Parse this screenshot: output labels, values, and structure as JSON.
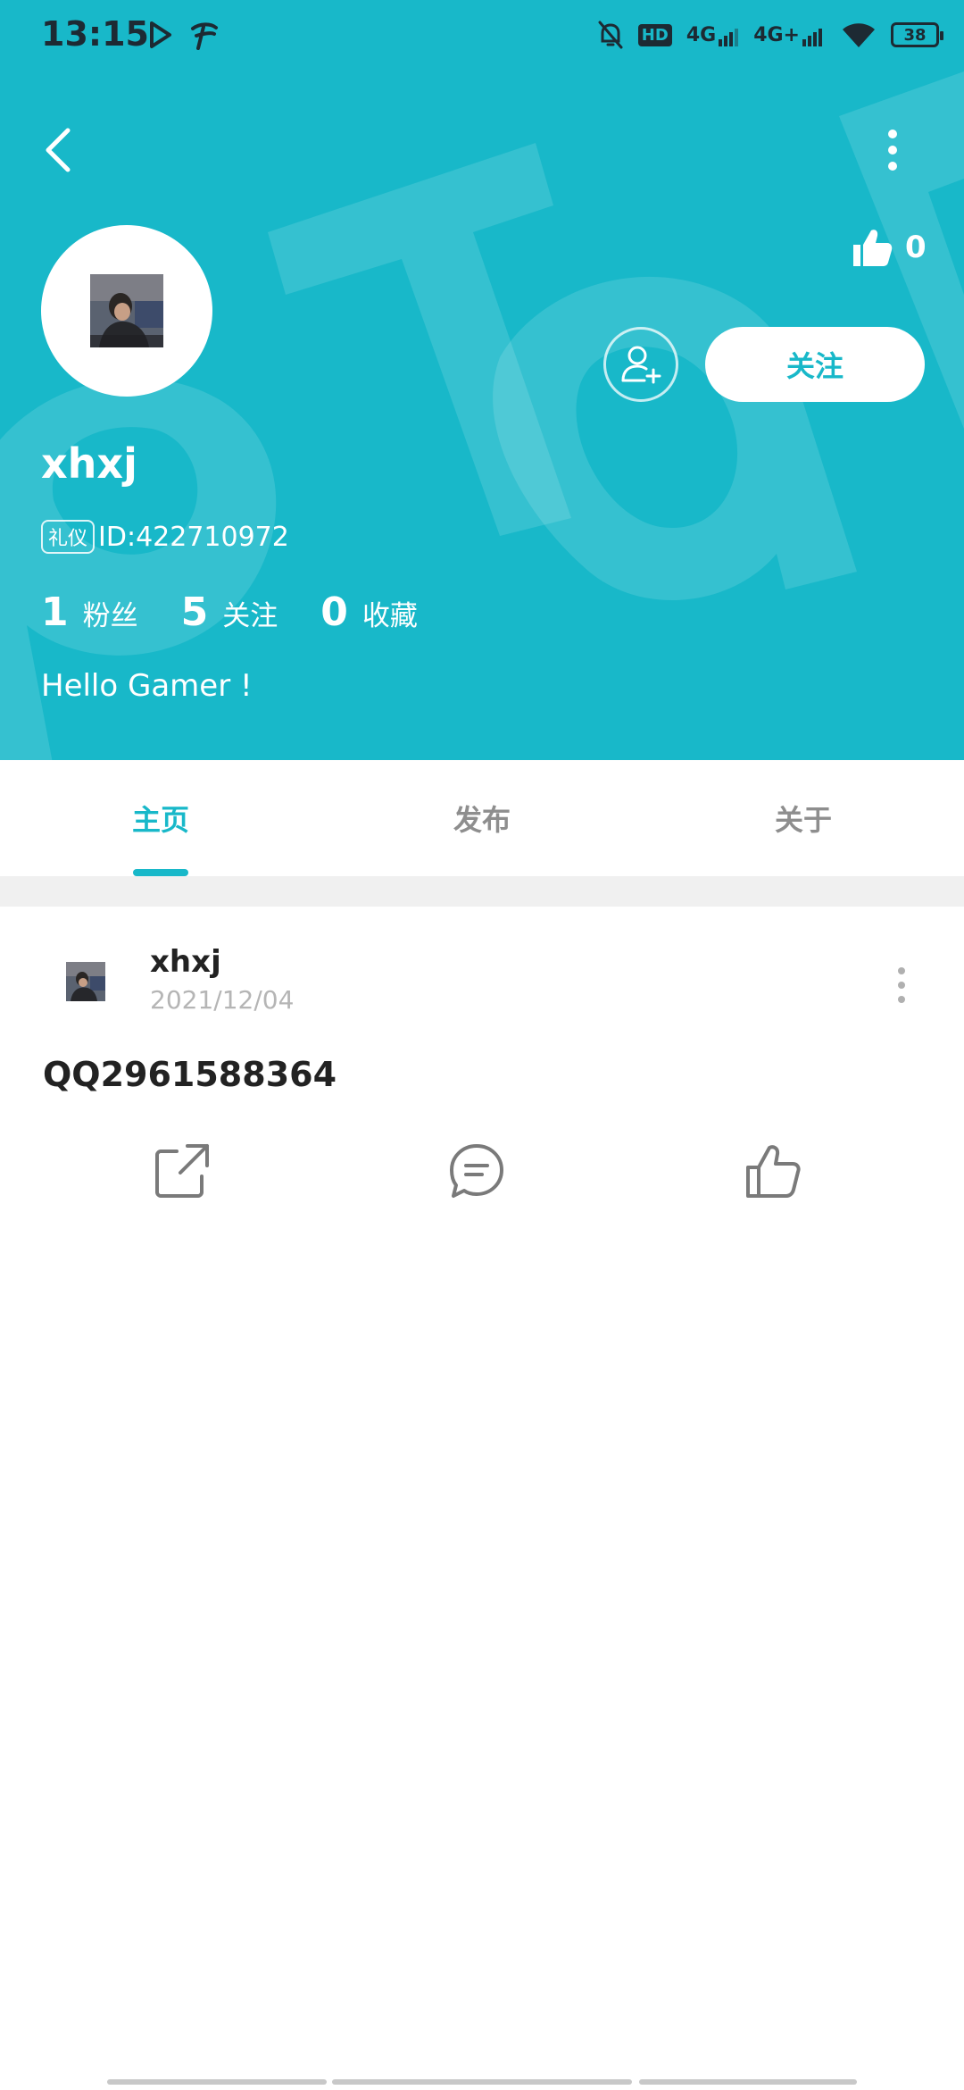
{
  "status_bar": {
    "time": "13:15",
    "hd_label": "HD",
    "sim1_label": "4G",
    "sim2_label": "4G+",
    "battery": "38"
  },
  "profile": {
    "username": "xhxj",
    "badge": "礼仪",
    "id_text": "ID:422710972",
    "likes": "0",
    "follow_label": "关注",
    "bio": "Hello Gamer !",
    "stats": [
      {
        "value": "1",
        "label": "粉丝"
      },
      {
        "value": "5",
        "label": "关注"
      },
      {
        "value": "0",
        "label": "收藏"
      }
    ]
  },
  "tabs": [
    {
      "label": "主页",
      "active": true
    },
    {
      "label": "发布",
      "active": false
    },
    {
      "label": "关于",
      "active": false
    }
  ],
  "post": {
    "author": "xhxj",
    "date": "2021/12/04",
    "text": "QQ2961588364"
  },
  "icons": {
    "back": "chevron-left-icon",
    "more": "more-vertical-icon",
    "thumb": "thumb-up-icon",
    "add_friend": "add-user-icon",
    "share": "share-icon",
    "comment": "comment-icon",
    "like": "thumb-up-outline-icon"
  },
  "colors": {
    "accent": "#18b8c9",
    "divider": "#f0f0f0",
    "muted_text": "#8e8e8e"
  }
}
